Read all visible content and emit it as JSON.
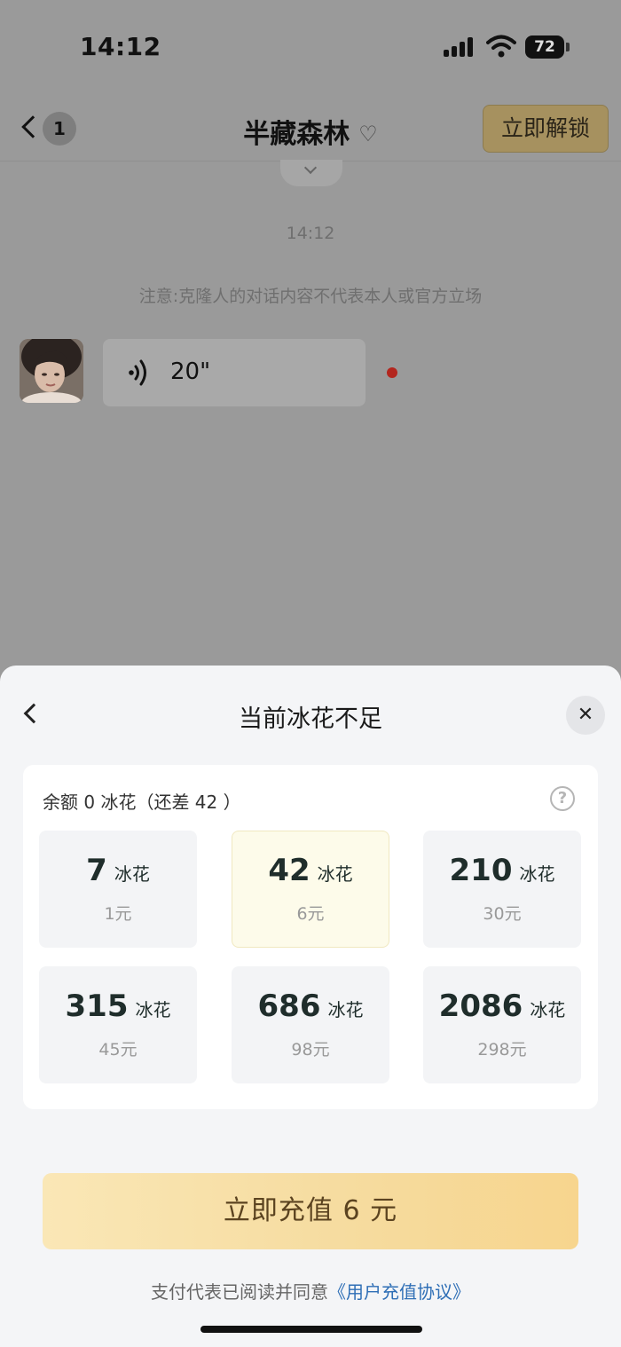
{
  "status_bar": {
    "time": "14:12",
    "battery": "72"
  },
  "nav": {
    "unread_count": "1",
    "title": "半藏森林",
    "unlock_label": "立即解锁"
  },
  "chat": {
    "timestamp": "14:12",
    "notice": "注意:克隆人的对话内容不代表本人或官方立场",
    "voice_duration": "20\""
  },
  "sheet": {
    "title": "当前冰花不足",
    "close_label": "✕",
    "balance_text": "余额 0 冰花（还差 42 ）",
    "help_label": "?",
    "unit": "冰花",
    "packages": [
      {
        "amount": "7",
        "price": "1元",
        "selected": false
      },
      {
        "amount": "42",
        "price": "6元",
        "selected": true
      },
      {
        "amount": "210",
        "price": "30元",
        "selected": false
      },
      {
        "amount": "315",
        "price": "45元",
        "selected": false
      },
      {
        "amount": "686",
        "price": "98元",
        "selected": false
      },
      {
        "amount": "2086",
        "price": "298元",
        "selected": false
      }
    ],
    "pay_button": "立即充值 6 元",
    "agreement_prefix": "支付代表已阅读并同意",
    "agreement_link": "《用户充值协议》"
  },
  "colors": {
    "accent_gold": "#f6dca0",
    "link_blue": "#2f6fb6",
    "unread_dot": "#b3261e"
  }
}
